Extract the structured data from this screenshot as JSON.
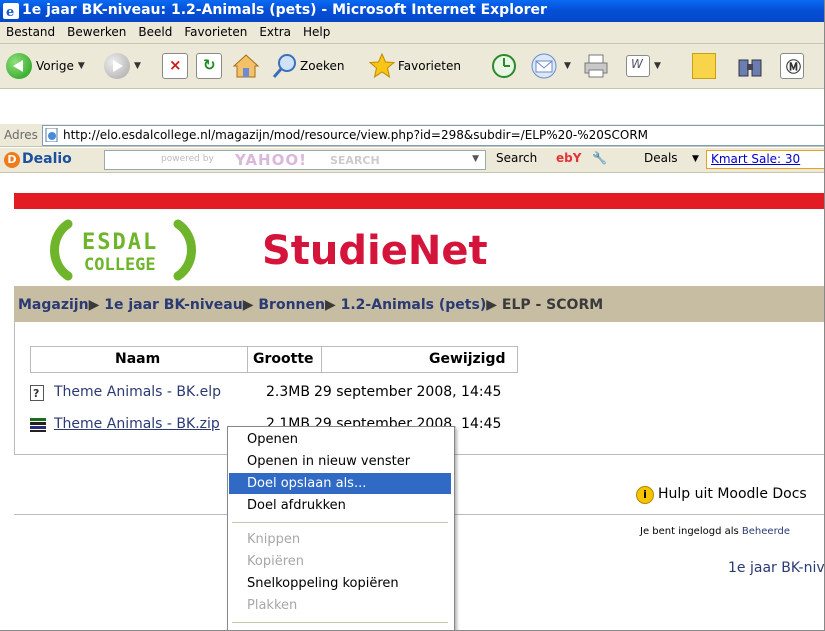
{
  "window": {
    "title": "1e jaar BK-niveau: 1.2-Animals (pets) - Microsoft Internet Explorer"
  },
  "menu": [
    "Bestand",
    "Bewerken",
    "Beeld",
    "Favorieten",
    "Extra",
    "Help"
  ],
  "toolbar": {
    "back_label": "Vorige",
    "search_label": "Zoeken",
    "favorites_label": "Favorieten"
  },
  "address": {
    "label": "Adres",
    "url": "http://elo.esdalcollege.nl/magazijn/mod/resource/view.php?id=298&subdir=/ELP%20-%20SCORM"
  },
  "dealio": {
    "brand": "Dealio",
    "powered_by": "powered by",
    "yahoo_logo": "YAHOO!",
    "yahoo_search": "SEARCH",
    "search_button": "Search",
    "ebay": "ebY",
    "deals": "Deals",
    "kmart": "Kmart Sale: 30"
  },
  "site": {
    "logo_top": "ESDAL",
    "logo_bottom": "COLLEGE",
    "name": "StudieNet"
  },
  "breadcrumb": {
    "items": [
      "Magazijn",
      "1e jaar BK-niveau",
      "Bronnen",
      "1.2-Animals (pets)"
    ],
    "current": "ELP - SCORM",
    "sep": "▶"
  },
  "table": {
    "headers": [
      "Naam",
      "Grootte",
      "Gewijzigd"
    ],
    "rows": [
      {
        "name": "Theme Animals - BK.elp",
        "size": "2.3MB",
        "modified": "29 september 2008, 14:45"
      },
      {
        "name": "Theme Animals - BK.zip",
        "size": "2.1MB",
        "modified": "29 september 2008, 14:45"
      }
    ]
  },
  "help_link": "Hulp uit Moodle Docs",
  "login": {
    "prefix": "Je bent ingelogd als",
    "user": "Beheerde"
  },
  "footer_link": "1e jaar BK-niv",
  "context_menu": {
    "items": [
      {
        "label": "Openen",
        "state": "normal"
      },
      {
        "label": "Openen in nieuw venster",
        "state": "normal"
      },
      {
        "label": "Doel opslaan als...",
        "state": "selected"
      },
      {
        "label": "Doel afdrukken",
        "state": "normal"
      },
      {
        "label": "Knippen",
        "state": "disabled"
      },
      {
        "label": "Kopiëren",
        "state": "disabled"
      },
      {
        "label": "Snelkoppeling kopiëren",
        "state": "normal"
      },
      {
        "label": "Plakken",
        "state": "disabled"
      }
    ]
  }
}
